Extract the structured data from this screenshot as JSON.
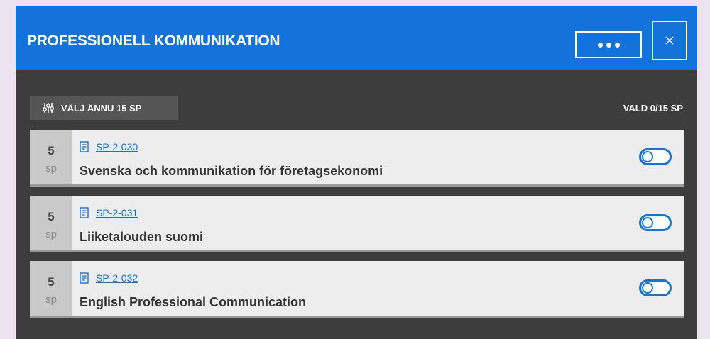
{
  "header": {
    "title": "PROFESSIONELL KOMMUNIKATION",
    "more_label": "more-options",
    "close_label": "close"
  },
  "toolbar": {
    "choose_label": "VÄLJ ÄNNU 15 SP",
    "selected_label": "VALD 0/15 SP"
  },
  "courses": [
    {
      "credits": "5",
      "unit": "sp",
      "code": "SP-2-030",
      "name": "Svenska och kommunikation för företagsekonomi",
      "selected": false
    },
    {
      "credits": "5",
      "unit": "sp",
      "code": "SP-2-031",
      "name": "Liiketalouden suomi",
      "selected": false
    },
    {
      "credits": "5",
      "unit": "sp",
      "code": "SP-2-032",
      "name": "English Professional Communication",
      "selected": false
    }
  ],
  "colors": {
    "accent": "#1473db",
    "panel_bg": "#3d3d3d",
    "page_bg": "#ede3f0",
    "card_bg": "#ededed",
    "credits_bg": "#c9c9c9"
  },
  "icons": {
    "filter": "sliders-icon",
    "course": "document-icon",
    "close": "close-icon",
    "more": "ellipsis-icon"
  }
}
